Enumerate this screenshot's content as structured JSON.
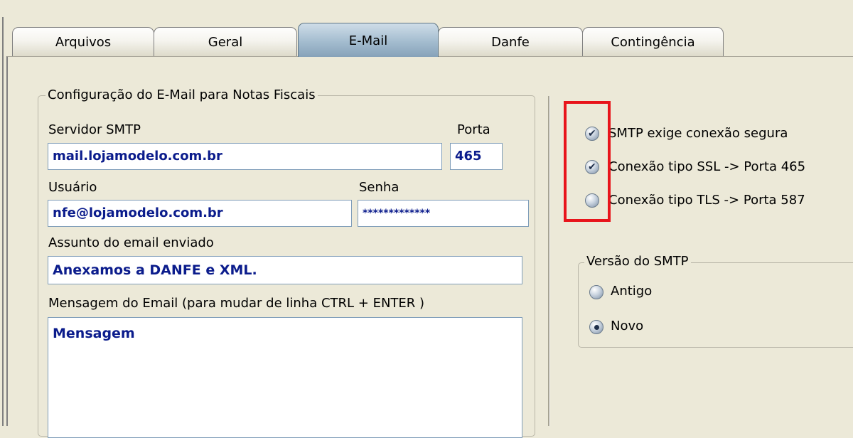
{
  "tabs": [
    {
      "label": "Arquivos",
      "active": false
    },
    {
      "label": "Geral",
      "active": false
    },
    {
      "label": "E-Mail",
      "active": true
    },
    {
      "label": "Danfe",
      "active": false
    },
    {
      "label": "Contingência",
      "active": false
    }
  ],
  "email_group": {
    "legend": "Configuração do E-Mail para Notas Fiscais",
    "smtp_server_label": "Servidor SMTP",
    "smtp_server_value": "mail.lojamodelo.com.br",
    "port_label": "Porta",
    "port_value": "465",
    "user_label": "Usuário",
    "user_value": "nfe@lojamodelo.com.br",
    "password_label": "Senha",
    "password_value": "*************",
    "subject_label": "Assunto do email enviado",
    "subject_value": "Anexamos a DANFE e XML.",
    "message_label": "Mensagem do Email (para mudar de linha CTRL + ENTER )",
    "message_value": "Mensagem"
  },
  "security_options": [
    {
      "label": "SMTP exige conexão segura",
      "checked": true
    },
    {
      "label": "Conexão tipo SSL -> Porta 465",
      "checked": true
    },
    {
      "label": "Conexão tipo TLS -> Porta 587",
      "checked": false
    }
  ],
  "smtp_version": {
    "legend": "Versão do SMTP",
    "options": [
      {
        "label": "Antigo",
        "selected": false
      },
      {
        "label": "Novo",
        "selected": true
      }
    ]
  },
  "colors": {
    "highlight": "#e8141b",
    "field_text": "#0b1c8c",
    "background": "#ece9d8"
  }
}
